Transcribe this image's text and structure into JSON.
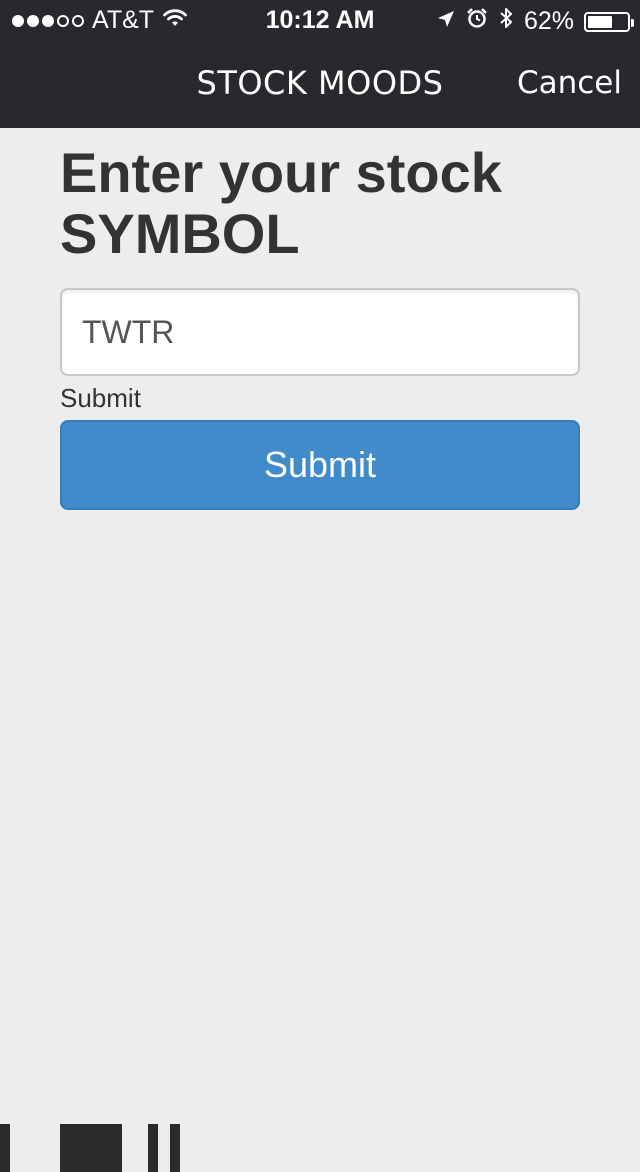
{
  "status_bar": {
    "carrier": "AT&T",
    "time": "10:12 AM",
    "battery": "62%",
    "battery_level": 0.62,
    "signal_bars_filled": 3,
    "signal_bars_total": 5,
    "icons": [
      "wifi-icon",
      "location-arrow-icon",
      "alarm-clock-icon",
      "bluetooth-icon",
      "battery-icon"
    ]
  },
  "nav": {
    "title": "STOCK MOODS",
    "cancel_label": "Cancel"
  },
  "form": {
    "heading": "Enter your stock SYMBOL",
    "symbol_value": "TWTR",
    "submit_label_text": "Submit",
    "submit_button_label": "Submit"
  },
  "colors": {
    "topbar": "#27292d",
    "background": "#ededed",
    "button": "#428bca",
    "text": "#333333"
  }
}
